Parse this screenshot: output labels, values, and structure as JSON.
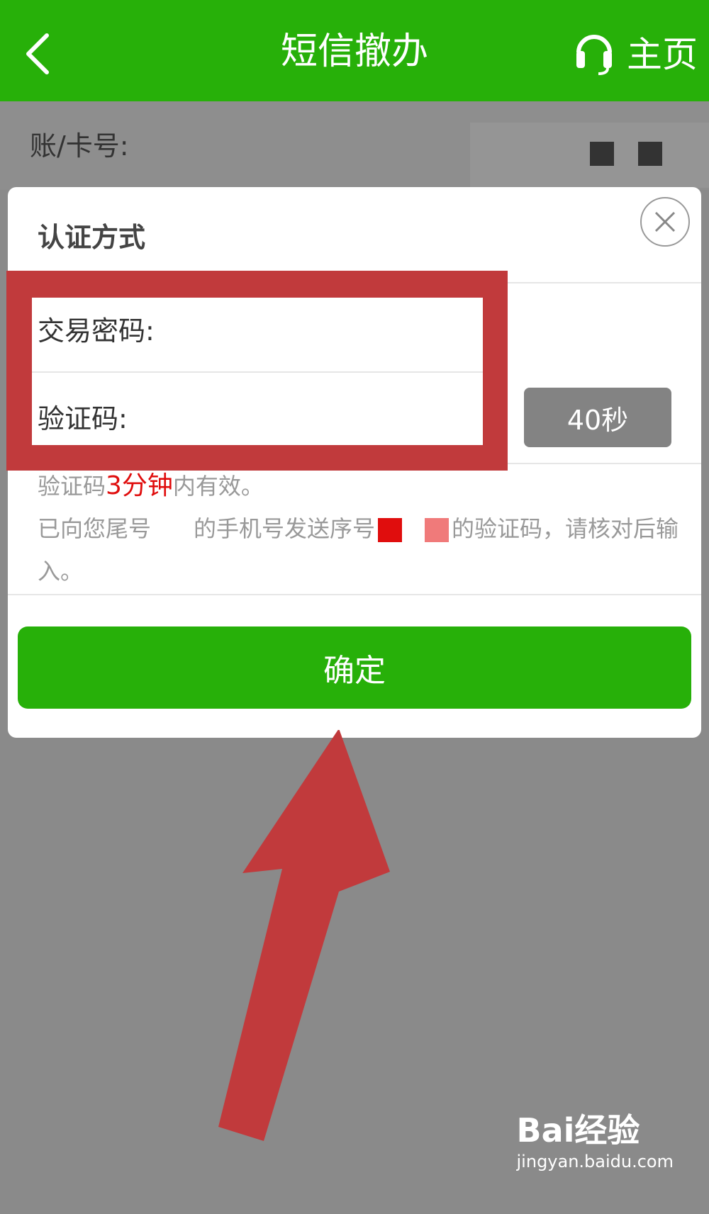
{
  "header": {
    "title": "短信撤办",
    "home_label": "主页"
  },
  "account": {
    "label": "账/卡号:"
  },
  "dialog": {
    "title": "认证方式",
    "password_label": "交易密码:",
    "code_label": "验证码:",
    "timer_label": "40秒",
    "hint_prefix": "验证码",
    "hint_highlight": "3分钟",
    "hint_suffix": "内有效。",
    "sms_part1": "已向您尾号",
    "sms_part2": "的手机号发送序号",
    "sms_part3": "的验证码，请核对后输",
    "sms_part4": "入。",
    "confirm_label": "确定"
  },
  "watermark": {
    "logo": "Bai经验",
    "url": "jingyan.baidu.com"
  },
  "colors": {
    "brand_green": "#27b009",
    "annotation_red": "#c13a3c",
    "highlight_red": "#e00d0d"
  }
}
